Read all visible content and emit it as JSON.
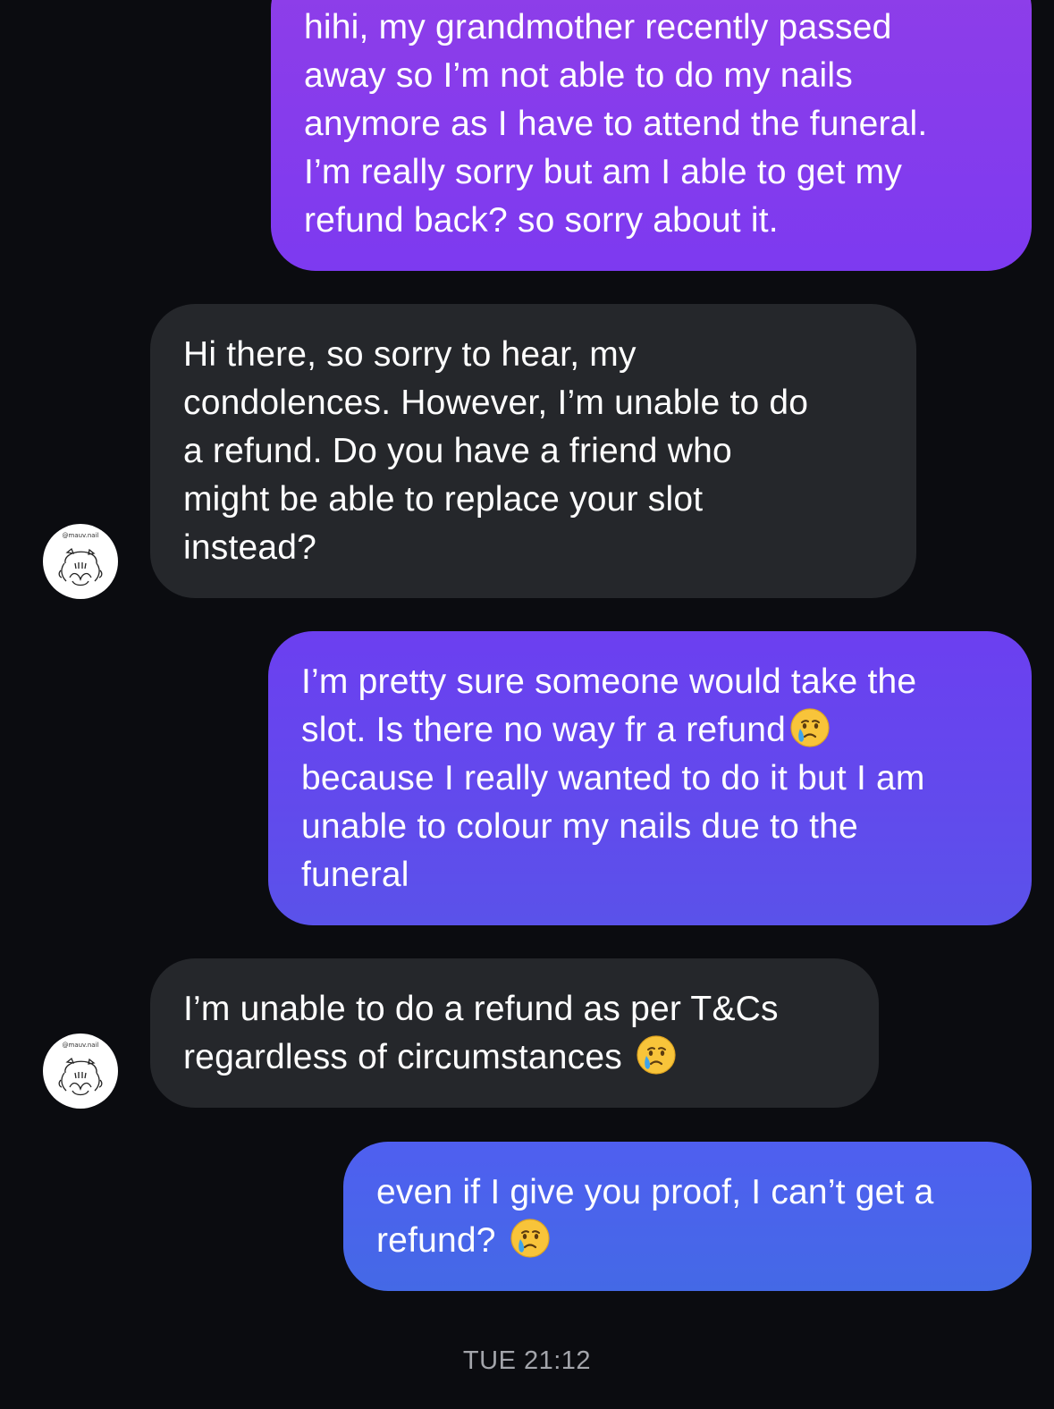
{
  "conversation": {
    "messages": [
      {
        "sender": "me",
        "text": "hihi, my grandmother recently passed\naway so I’m not able to do my nails\nanymore as I have to attend the funeral.\nI’m really sorry but am I able to get my\nrefund back? so sorry about it."
      },
      {
        "sender": "them",
        "text": "Hi there, so sorry to hear, my\ncondolences. However, I’m unable to do\na refund. Do you have a friend who\nmight be able to replace your slot\ninstead?"
      },
      {
        "sender": "me",
        "text_before_emoji": "I’m pretty sure someone would take the\nslot. Is there no way fr a refund",
        "emoji": "crying-smile-emoji",
        "text_after_emoji": "\nbecause I really wanted to do it but I am\nunable to colour my nails due to the\nfuneral"
      },
      {
        "sender": "them",
        "text_before_emoji": "I’m unable to do a refund as per T&Cs\nregardless of circumstances ",
        "emoji": "crying-smile-emoji"
      },
      {
        "sender": "me",
        "text_before_emoji": "even if I give you proof, I can’t get a\nrefund? ",
        "emoji": "crying-smile-emoji"
      }
    ],
    "timestamp": "TUE 21:12"
  },
  "contact": {
    "avatar_handle": "@mauv.nail"
  },
  "colors": {
    "background": "#0b0c10",
    "received_bubble": "#25272b",
    "sent_gradient_top": "#8f3ee8",
    "sent_gradient_bottom": "#4469e6",
    "timestamp_text": "#a3a5ab"
  }
}
